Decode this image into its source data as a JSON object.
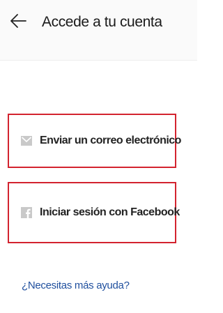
{
  "header": {
    "title": "Accede a tu cuenta",
    "back_icon": "arrow-left-icon"
  },
  "options": [
    {
      "label": "Enviar un correo electrónico",
      "icon": "envelope-icon"
    },
    {
      "label": "Iniciar sesión con Facebook",
      "icon": "facebook-icon"
    }
  ],
  "help": {
    "label": "¿Necesitas más ayuda?"
  },
  "colors": {
    "highlight_border": "#d3232f",
    "link": "#1f4f9e",
    "icon_gray": "#c9c9c9"
  }
}
